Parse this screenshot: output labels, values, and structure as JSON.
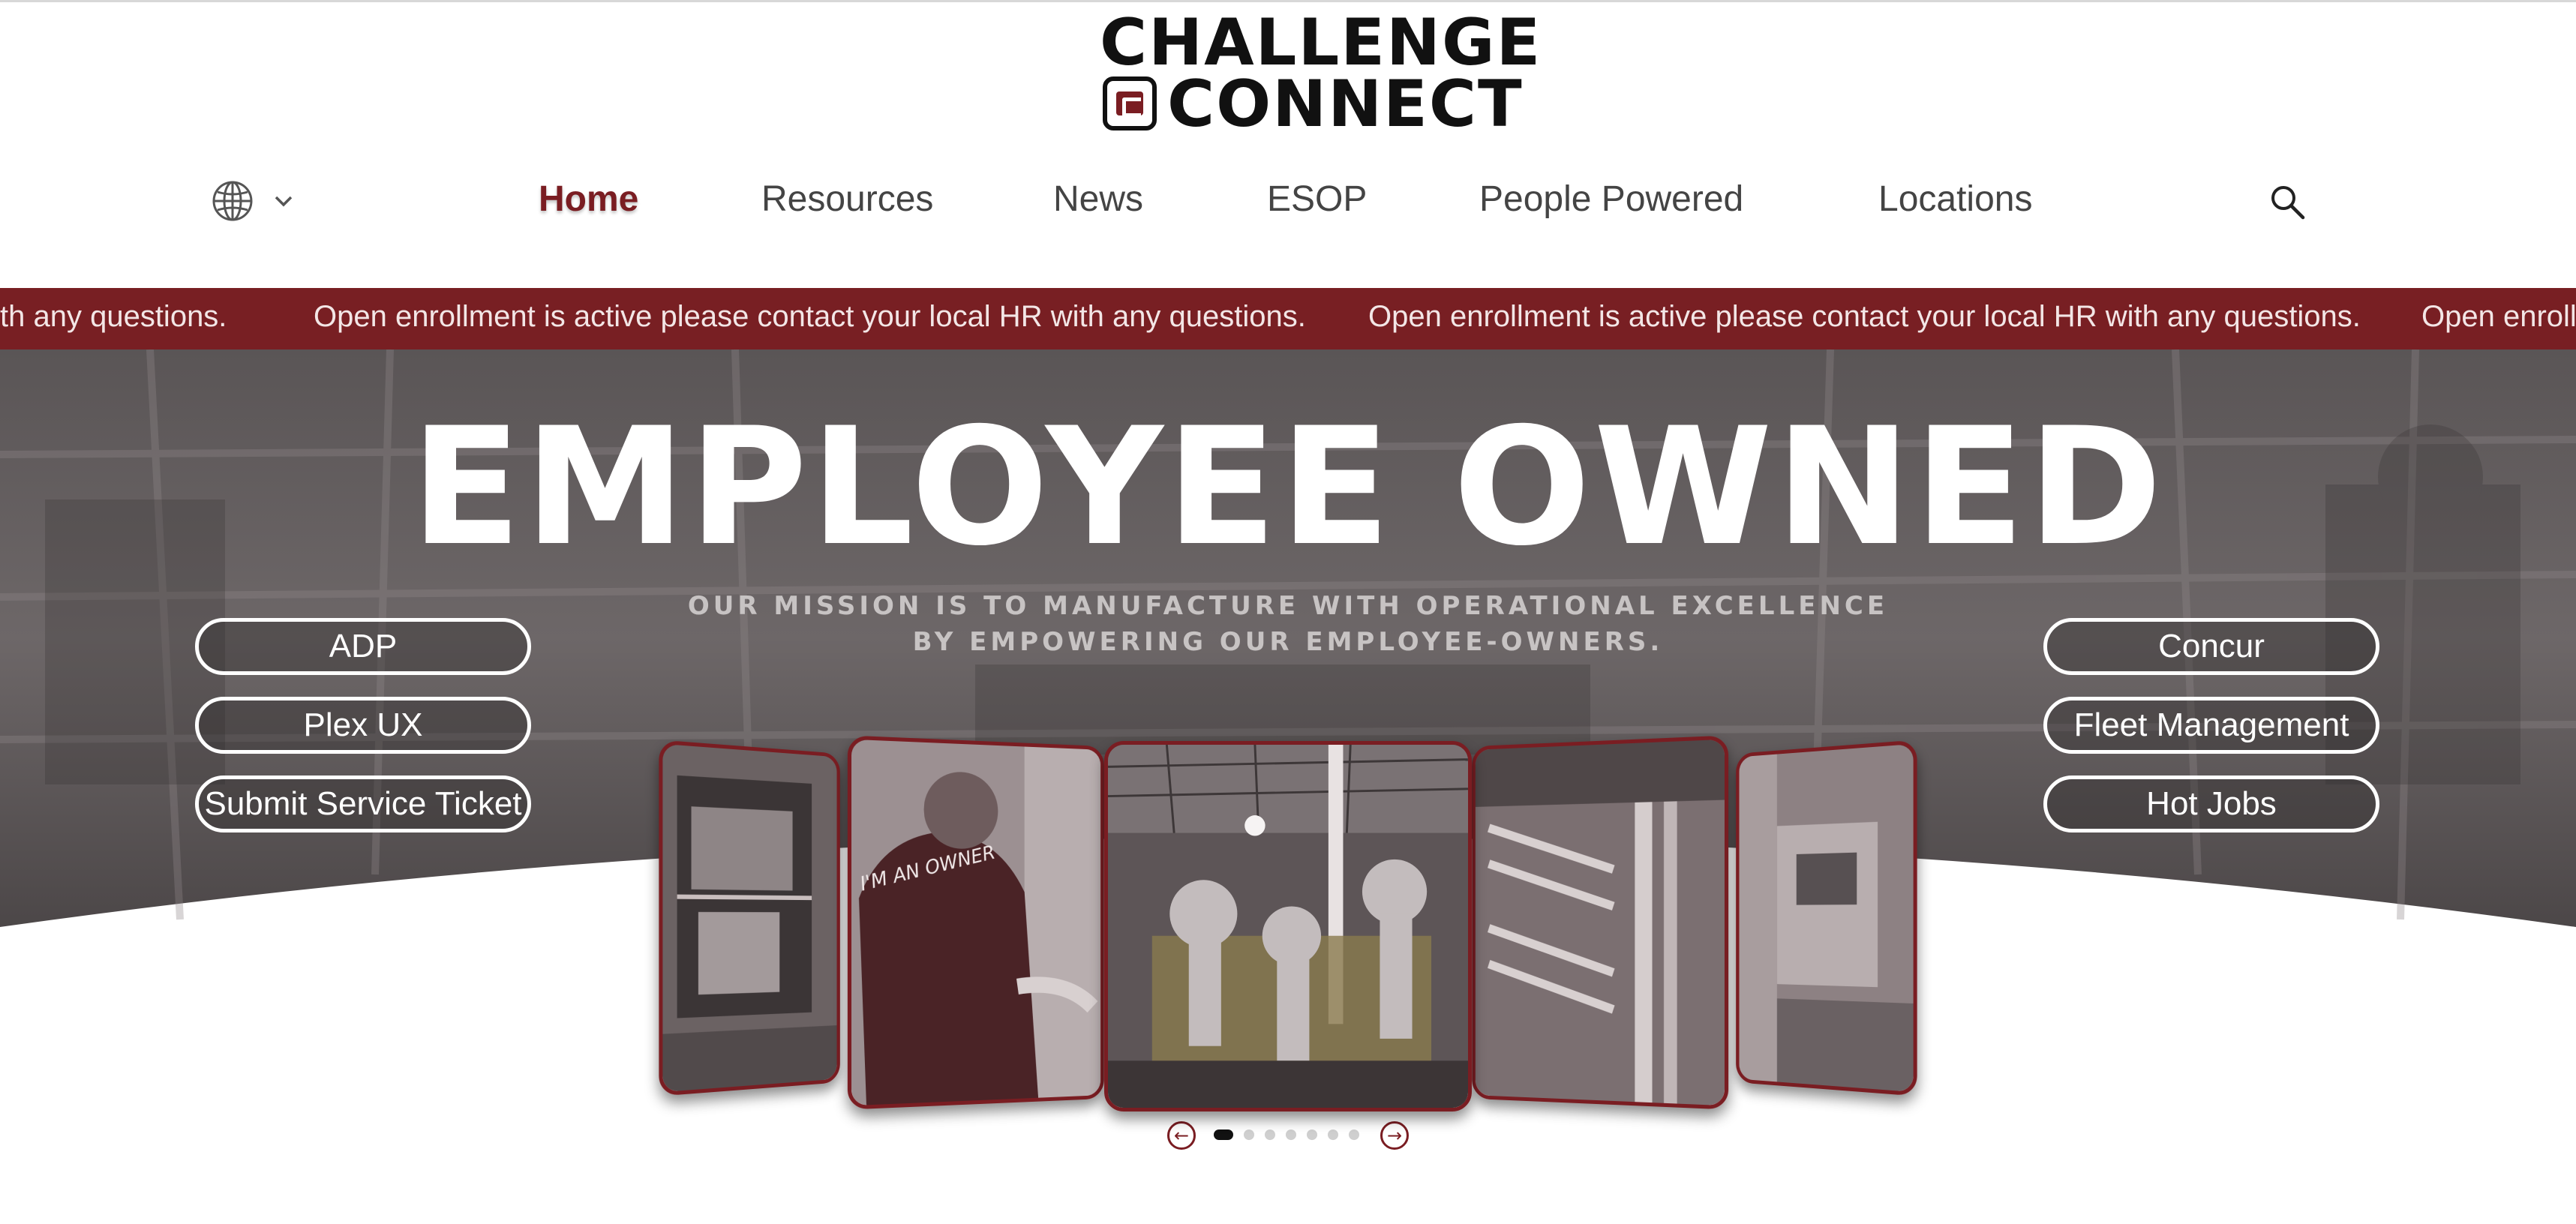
{
  "brand": {
    "line1": "CHALLENGE",
    "line2": "CONNECT",
    "accent": "#7a1d22"
  },
  "nav": {
    "language_icon": "globe-icon",
    "search_icon": "search-icon",
    "items": [
      {
        "label": "Home",
        "active": true
      },
      {
        "label": "Resources"
      },
      {
        "label": "News"
      },
      {
        "label": "ESOP"
      },
      {
        "label": "People Powered"
      },
      {
        "label": "Locations"
      }
    ]
  },
  "ticker": {
    "message": "Open enrollment is active please contact your local HR with any questions.",
    "partial_left": "th any questions.",
    "partial_right": "Open enroll"
  },
  "hero": {
    "title": "EMPLOYEE OWNED",
    "mission": "OUR MISSION IS TO MANUFACTURE WITH OPERATIONAL EXCELLENCE BY EMPOWERING OUR EMPLOYEE-OWNERS."
  },
  "quick_links_left": [
    "ADP",
    "Plex UX",
    "Submit Service Ticket"
  ],
  "quick_links_right": [
    "Concur",
    "Fleet Management",
    "Hot Jobs"
  ],
  "carousel": {
    "slide_count": 7,
    "active_slide": 1,
    "shirt_text": "I'M AN OWNER",
    "prev_icon": "arrow-left-icon",
    "next_icon": "arrow-right-icon"
  }
}
